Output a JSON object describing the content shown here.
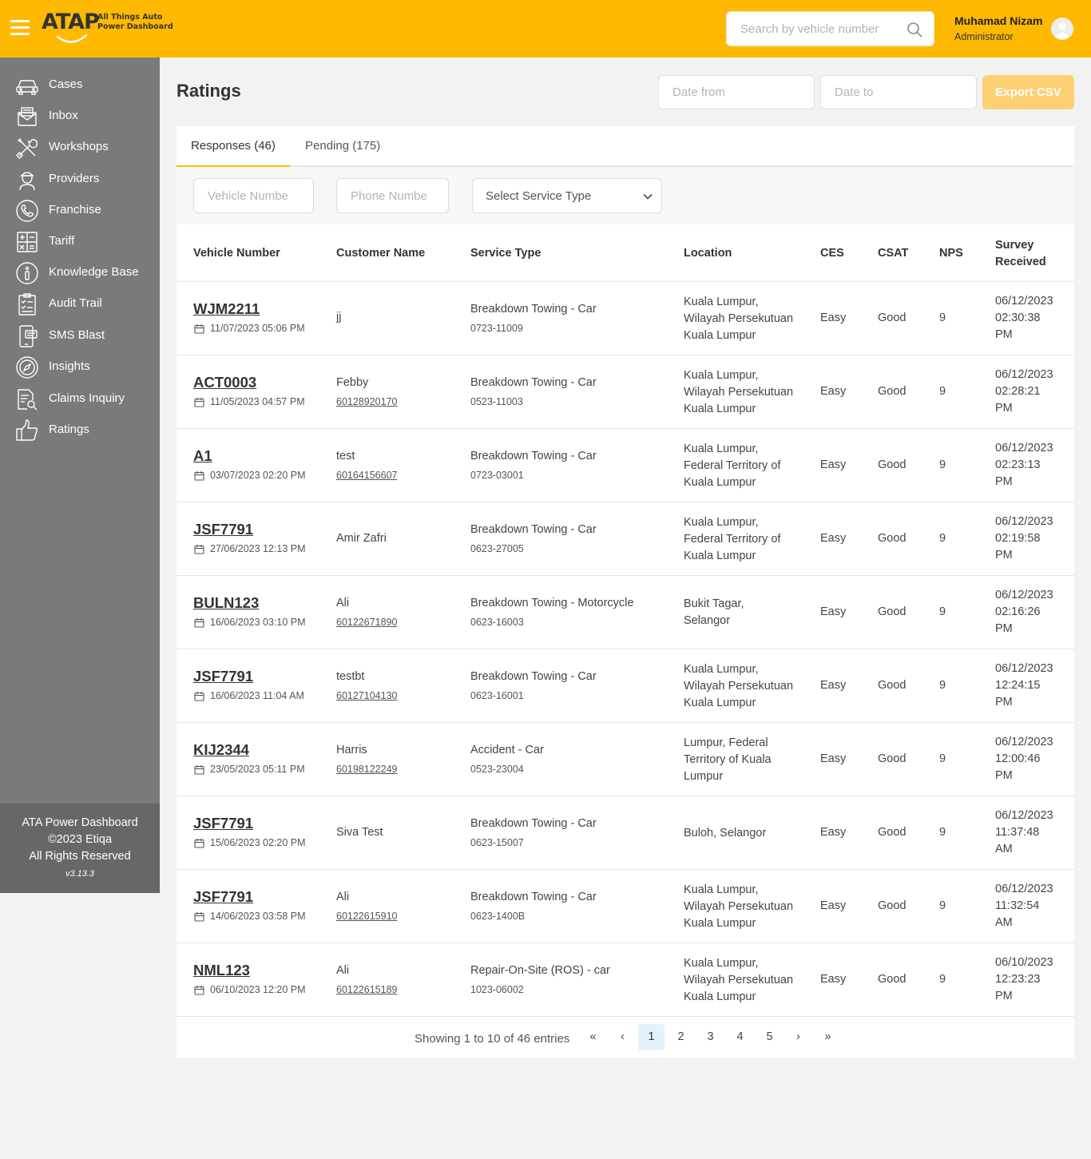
{
  "header": {
    "brand": "ATAP",
    "brand_sub_1": "All Things Auto",
    "brand_sub_2": "Power Dashboard",
    "search_placeholder": "Search by vehicle number",
    "user_name": "Muhamad Nizam",
    "user_role": "Administrator"
  },
  "sidebar": {
    "items": [
      {
        "label": "Cases",
        "icon": "car-icon"
      },
      {
        "label": "Inbox",
        "icon": "inbox-icon"
      },
      {
        "label": "Workshops",
        "icon": "tools-icon"
      },
      {
        "label": "Providers",
        "icon": "provider-icon"
      },
      {
        "label": "Franchise",
        "icon": "phone-icon"
      },
      {
        "label": "Tariff",
        "icon": "calculator-icon"
      },
      {
        "label": "Knowledge Base",
        "icon": "info-icon"
      },
      {
        "label": "Audit Trail",
        "icon": "checklist-icon"
      },
      {
        "label": "SMS Blast",
        "icon": "sms-icon"
      },
      {
        "label": "Insights",
        "icon": "compass-icon"
      },
      {
        "label": "Claims Inquiry",
        "icon": "document-search-icon"
      },
      {
        "label": "Ratings",
        "icon": "thumbs-up-icon"
      }
    ],
    "footer_line1": "ATA Power Dashboard",
    "footer_line2": "©2023 Etiqa",
    "footer_line3": "All Rights Reserved",
    "version": "v3.13.3"
  },
  "page": {
    "title": "Ratings",
    "date_from_placeholder": "Date from",
    "date_to_placeholder": "Date to",
    "export_label": "Export CSV"
  },
  "tabs": [
    {
      "label": "Responses (46)",
      "active": true
    },
    {
      "label": "Pending (175)",
      "active": false
    }
  ],
  "filters": {
    "vehicle_placeholder": "Vehicle Numbe",
    "phone_placeholder": "Phone Numbe",
    "service_placeholder": "Select Service Type"
  },
  "table": {
    "columns": {
      "vehicle": "Vehicle Number",
      "customer": "Customer Name",
      "service": "Service Type",
      "location": "Location",
      "ces": "CES",
      "csat": "CSAT",
      "nps": "NPS",
      "survey1": "Survey",
      "survey2": "Received"
    },
    "rows": [
      {
        "vehicle": "WJM2211",
        "date": "11/07/2023 05:06 PM",
        "name": "jj",
        "phone": "",
        "service": "Breakdown Towing - Car",
        "case": "0723-11009",
        "location": [
          "Kuala Lumpur,",
          "Wilayah Persekutuan",
          "Kuala Lumpur"
        ],
        "ces": "Easy",
        "csat": "Good",
        "nps": "9",
        "survey": [
          "06/12/2023",
          "02:30:38",
          "PM"
        ]
      },
      {
        "vehicle": "ACT0003",
        "date": "11/05/2023 04:57 PM",
        "name": "Febby",
        "phone": "60128920170",
        "service": "Breakdown Towing - Car",
        "case": "0523-11003",
        "location": [
          "Kuala Lumpur,",
          "Wilayah Persekutuan",
          "Kuala Lumpur"
        ],
        "ces": "Easy",
        "csat": "Good",
        "nps": "9",
        "survey": [
          "06/12/2023",
          "02:28:21",
          "PM"
        ]
      },
      {
        "vehicle": "A1",
        "date": "03/07/2023 02:20 PM",
        "name": "test",
        "phone": "60164156607",
        "service": "Breakdown Towing - Car",
        "case": "0723-03001",
        "location": [
          "Kuala Lumpur,",
          "Federal Territory of",
          "Kuala Lumpur"
        ],
        "ces": "Easy",
        "csat": "Good",
        "nps": "9",
        "survey": [
          "06/12/2023",
          "02:23:13",
          "PM"
        ]
      },
      {
        "vehicle": "JSF7791",
        "date": "27/06/2023 12:13 PM",
        "name": "Amir Zafri",
        "phone": "",
        "service": "Breakdown Towing - Car",
        "case": "0623-27005",
        "location": [
          "Kuala Lumpur,",
          "Federal Territory of",
          "Kuala Lumpur"
        ],
        "ces": "Easy",
        "csat": "Good",
        "nps": "9",
        "survey": [
          "06/12/2023",
          "02:19:58",
          "PM"
        ]
      },
      {
        "vehicle": "BULN123",
        "date": "16/06/2023 03:10 PM",
        "name": "Ali",
        "phone": "60122671890",
        "service": "Breakdown Towing - Motorcycle",
        "case": "0623-16003",
        "location": [
          "Bukit Tagar,",
          "Selangor"
        ],
        "ces": "Easy",
        "csat": "Good",
        "nps": "9",
        "survey": [
          "06/12/2023",
          "02:16:26",
          "PM"
        ]
      },
      {
        "vehicle": "JSF7791",
        "date": "16/06/2023 11:04 AM",
        "name": "testbt",
        "phone": "60127104130",
        "service": "Breakdown Towing - Car",
        "case": "0623-16001",
        "location": [
          "Kuala Lumpur,",
          "Wilayah Persekutuan",
          "Kuala Lumpur"
        ],
        "ces": "Easy",
        "csat": "Good",
        "nps": "9",
        "survey": [
          "06/12/2023",
          "12:24:15",
          "PM"
        ]
      },
      {
        "vehicle": "KIJ2344",
        "date": "23/05/2023 05:11 PM",
        "name": "Harris",
        "phone": "60198122249",
        "service": "Accident - Car",
        "case": "0523-23004",
        "location": [
          "Lumpur, Federal",
          "Territory of Kuala",
          "Lumpur"
        ],
        "ces": "Easy",
        "csat": "Good",
        "nps": "9",
        "survey": [
          "06/12/2023",
          "12:00:46",
          "PM"
        ]
      },
      {
        "vehicle": "JSF7791",
        "date": "15/06/2023 02:20 PM",
        "name": "Siva Test",
        "phone": "",
        "service": "Breakdown Towing - Car",
        "case": "0623-15007",
        "location": [
          "Buloh, Selangor"
        ],
        "ces": "Easy",
        "csat": "Good",
        "nps": "9",
        "survey": [
          "06/12/2023",
          "11:37:48",
          "AM"
        ]
      },
      {
        "vehicle": "JSF7791",
        "date": "14/06/2023 03:58 PM",
        "name": "Ali",
        "phone": "60122615910",
        "service": "Breakdown Towing - Car",
        "case": "0623-1400B",
        "location": [
          "Kuala Lumpur,",
          "Wilayah Persekutuan",
          "Kuala Lumpur"
        ],
        "ces": "Easy",
        "csat": "Good",
        "nps": "9",
        "survey": [
          "06/12/2023",
          "11:32:54",
          "AM"
        ]
      },
      {
        "vehicle": "NML123",
        "date": "06/10/2023 12:20 PM",
        "name": "Ali",
        "phone": "60122615189",
        "service": "Repair-On-Site (ROS) - car",
        "case": "1023-06002",
        "location": [
          "Kuala Lumpur,",
          "Wilayah Persekutuan",
          "Kuala Lumpur"
        ],
        "ces": "Easy",
        "csat": "Good",
        "nps": "9",
        "survey": [
          "06/10/2023",
          "12:23:23",
          "PM"
        ]
      }
    ]
  },
  "pagination": {
    "info": "Showing 1 to 10 of 46 entries",
    "first": "«",
    "prev": "‹",
    "next": "›",
    "last": "»",
    "pages": [
      "1",
      "2",
      "3",
      "4",
      "5"
    ],
    "current": "1"
  },
  "colors": {
    "header": "#ffb900",
    "sidebar": "#7a7a7a",
    "sidebar_footer": "#676767",
    "export_button": "#fdd073",
    "current_page": "#e3f3fc"
  }
}
